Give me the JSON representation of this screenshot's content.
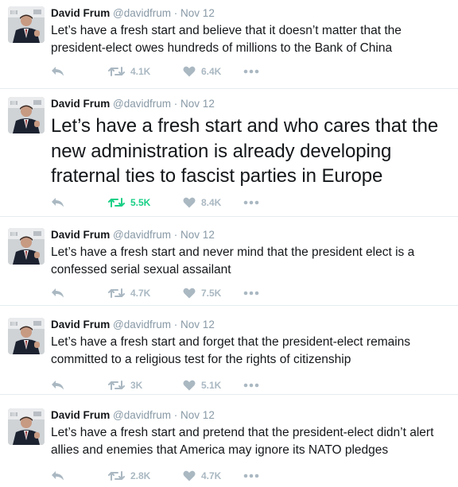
{
  "colors": {
    "name": "#14171a",
    "meta": "#8899a6",
    "action": "#aab8c2",
    "retweeted": "#19cf86",
    "divider": "#e6ecf0"
  },
  "icons": {
    "reply": "reply-icon",
    "retweet": "retweet-icon",
    "like": "heart-icon",
    "more": "more-dots-icon"
  },
  "tweets": [
    {
      "author": "David Frum",
      "handle": "@davidfrum",
      "separator": "·",
      "time": "Nov 12",
      "text": "Let’s have a fresh start and believe that it doesn’t matter that the president-elect owes hundreds of millions to the Bank of China",
      "retweets": "4.1K",
      "likes": "6.4K",
      "retweeted": false
    },
    {
      "author": "David Frum",
      "handle": "@davidfrum",
      "separator": "·",
      "time": "Nov 12",
      "text": "Let’s have a fresh start and who cares that the new administration is already developing fraternal ties to fascist parties in Europe",
      "retweets": "5.5K",
      "likes": "8.4K",
      "retweeted": true
    },
    {
      "author": "David Frum",
      "handle": "@davidfrum",
      "separator": "·",
      "time": "Nov 12",
      "text": "Let’s have a fresh start and never mind that the president elect is a confessed serial sexual assailant",
      "retweets": "4.7K",
      "likes": "7.5K",
      "retweeted": false
    },
    {
      "author": "David Frum",
      "handle": "@davidfrum",
      "separator": "·",
      "time": "Nov 12",
      "text": "Let’s have a fresh start and forget that the president-elect remains committed to a religious test for the rights of citizenship",
      "retweets": "3K",
      "likes": "5.1K",
      "retweeted": false
    },
    {
      "author": "David Frum",
      "handle": "@davidfrum",
      "separator": "·",
      "time": "Nov 12",
      "text": "Let’s have a fresh start and pretend that the president-elect didn’t alert allies and enemies that America may ignore its NATO pledges",
      "retweets": "2.8K",
      "likes": "4.7K",
      "retweeted": false
    }
  ]
}
